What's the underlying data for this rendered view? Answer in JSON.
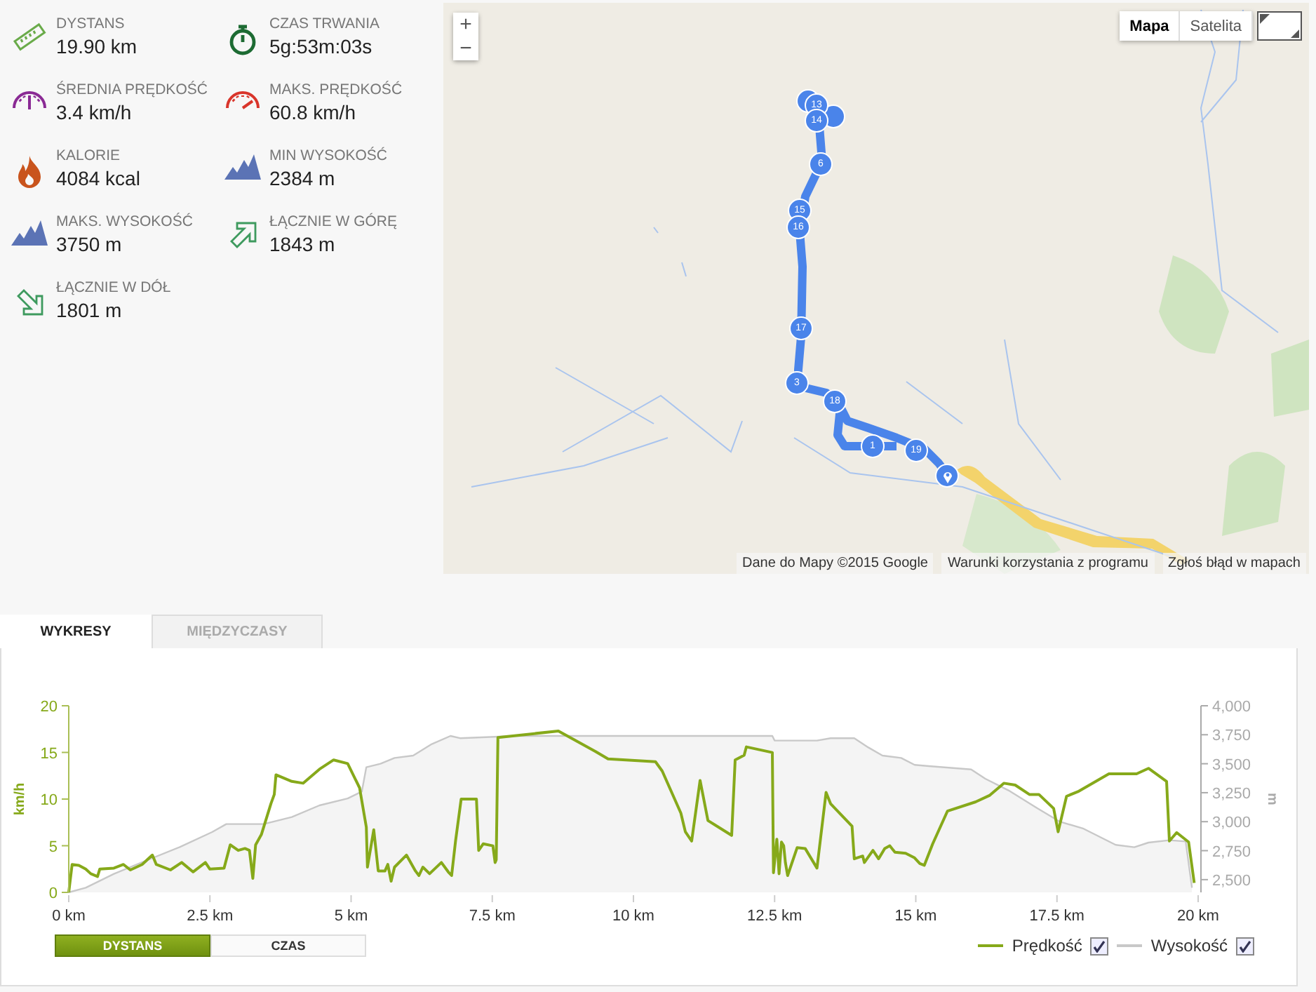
{
  "stats": [
    {
      "kind": "distance",
      "label": "DYSTANS",
      "value": "19.90 km"
    },
    {
      "kind": "duration",
      "label": "CZAS TRWANIA",
      "value": "5g:53m:03s"
    },
    {
      "kind": "avg_speed",
      "label": "ŚREDNIA PRĘDKOŚĆ",
      "value": "3.4 km/h"
    },
    {
      "kind": "max_speed",
      "label": "MAKS. PRĘDKOŚĆ",
      "value": "60.8 km/h"
    },
    {
      "kind": "calories",
      "label": "KALORIE",
      "value": "4084 kcal"
    },
    {
      "kind": "min_elevation",
      "label": "MIN WYSOKOŚĆ",
      "value": "2384 m"
    },
    {
      "kind": "max_elevation",
      "label": "MAKS. WYSOKOŚĆ",
      "value": "3750 m"
    },
    {
      "kind": "ascent",
      "label": "ŁĄCZNIE W GÓRĘ",
      "value": "1843 m"
    },
    {
      "kind": "descent",
      "label": "ŁĄCZNIE W DÓŁ",
      "value": "1801 m"
    }
  ],
  "map": {
    "zoom_in": "+",
    "zoom_out": "−",
    "map_types": [
      {
        "label": "Mapa",
        "selected": true
      },
      {
        "label": "Satelita",
        "selected": false
      }
    ],
    "markers": [
      {
        "kind": "blank"
      },
      {
        "kind": "blank"
      },
      {
        "kind": "number",
        "label": "13"
      },
      {
        "kind": "number",
        "label": "14"
      },
      {
        "kind": "number",
        "label": "6"
      },
      {
        "kind": "number",
        "label": "15"
      },
      {
        "kind": "number",
        "label": "16"
      },
      {
        "kind": "number",
        "label": "17"
      },
      {
        "kind": "number",
        "label": "3"
      },
      {
        "kind": "number",
        "label": "18"
      },
      {
        "kind": "number",
        "label": "1"
      },
      {
        "kind": "number",
        "label": "19"
      },
      {
        "kind": "pin"
      }
    ],
    "attribution": [
      "Dane do Mapy ©2015 Google",
      "Warunki korzystania z programu",
      "Zgłoś błąd w mapach"
    ]
  },
  "tabs": [
    {
      "label": "WYKRESY",
      "selected": true
    },
    {
      "label": "MIĘDZYCZASY",
      "selected": false
    }
  ],
  "chart": {
    "elevation_chart": {
      "chart_data": {
        "type": "area",
        "ylabel": "m",
        "xlim": [
          0,
          20
        ],
        "ylim": [
          2390,
          4000
        ],
        "yticks": [
          {
            "value": 2500,
            "label": "2,500"
          },
          {
            "value": 2750,
            "label": "2,750"
          },
          {
            "value": 3000,
            "label": "3,000"
          },
          {
            "value": 3250,
            "label": "3,250"
          },
          {
            "value": 3500,
            "label": "3,500"
          },
          {
            "value": 3750,
            "label": "3,750"
          },
          {
            "value": 4000,
            "label": "4,000"
          }
        ],
        "series": [
          {
            "color": "#c8c8c8",
            "x": [
              0,
              0.3,
              0.8,
              1.3,
              1.96,
              2.54,
              2.79,
              3.45,
              3.95,
              4.44,
              4.94,
              5.19,
              5.27,
              5.52,
              5.77,
              6.1,
              6.43,
              6.76,
              6.93,
              7.92,
              10.51,
              12.46,
              12.5,
              13.25,
              13.49,
              13.91,
              14.16,
              14.41,
              14.74,
              14.98,
              15.23,
              15.98,
              16.23,
              16.64,
              17.14,
              17.55,
              17.97,
              18.54,
              18.87,
              19.12,
              19.49,
              19.78,
              19.89
            ],
            "values": [
              2390,
              2430,
              2550,
              2650,
              2780,
              2910,
              2980,
              2980,
              3040,
              3140,
              3200,
              3260,
              3470,
              3500,
              3550,
              3570,
              3670,
              3740,
              3720,
              3740,
              3740,
              3740,
              3700,
              3700,
              3720,
              3720,
              3640,
              3570,
              3550,
              3490,
              3480,
              3450,
              3370,
              3270,
              3120,
              3000,
              2940,
              2800,
              2780,
              2820,
              2840,
              2830,
              2430
            ]
          }
        ]
      }
    },
    "speed_chart": {
      "chart_data": {
        "type": "line",
        "ylabel": "km/h",
        "xlim": [
          0,
          20
        ],
        "ylim": [
          0,
          20
        ],
        "xticks": [
          {
            "value": 0,
            "label": "0 km"
          },
          {
            "value": 2.5,
            "label": "2.5 km"
          },
          {
            "value": 5,
            "label": "5 km"
          },
          {
            "value": 7.5,
            "label": "7.5 km"
          },
          {
            "value": 10,
            "label": "10 km"
          },
          {
            "value": 12.5,
            "label": "12.5 km"
          },
          {
            "value": 15,
            "label": "15 km"
          },
          {
            "value": 17.5,
            "label": "17.5 km"
          },
          {
            "value": 20,
            "label": "20 km"
          }
        ],
        "yticks": [
          0,
          5,
          10,
          15,
          20
        ],
        "series": [
          {
            "color": "#86a91a",
            "x": [
              0,
              0.06,
              0.18,
              0.3,
              0.39,
              0.51,
              0.55,
              0.8,
              0.97,
              1.09,
              1.3,
              1.48,
              1.55,
              1.8,
              2.0,
              2.2,
              2.42,
              2.5,
              2.75,
              2.86,
              3.0,
              3.12,
              3.2,
              3.26,
              3.31,
              3.41,
              3.58,
              3.64,
              3.67,
              3.95,
              4.15,
              4.44,
              4.69,
              4.94,
              5.15,
              5.27,
              5.29,
              5.4,
              5.48,
              5.6,
              5.65,
              5.71,
              5.77,
              5.98,
              6.14,
              6.2,
              6.27,
              6.39,
              6.6,
              6.72,
              6.78,
              6.85,
              6.95,
              7.22,
              7.26,
              7.34,
              7.51,
              7.55,
              7.57,
              7.6,
              8.67,
              9.33,
              9.55,
              10.39,
              10.51,
              10.84,
              10.92,
              11.03,
              11.18,
              11.32,
              11.74,
              11.8,
              11.96,
              12.0,
              12.46,
              12.48,
              12.54,
              12.58,
              12.62,
              12.66,
              12.69,
              12.73,
              12.9,
              13.04,
              13.25,
              13.41,
              13.49,
              13.87,
              13.91,
              14.06,
              14.09,
              14.24,
              14.34,
              14.45,
              14.54,
              14.63,
              14.82,
              14.98,
              15.07,
              15.15,
              15.3,
              15.56,
              16.06,
              16.31,
              16.56,
              16.76,
              17.01,
              17.18,
              17.44,
              17.52,
              17.67,
              17.87,
              18.42,
              18.91,
              19.12,
              19.44,
              19.49,
              19.62,
              19.83,
              19.93
            ],
            "values": [
              0,
              3,
              2.9,
              2.5,
              2,
              1.7,
              2.5,
              2.6,
              3,
              2.4,
              3,
              4,
              3,
              2.4,
              3.2,
              2.2,
              3.2,
              2.5,
              2.6,
              5.1,
              4.5,
              4.7,
              4.5,
              1.5,
              5.1,
              6.2,
              9.5,
              10.5,
              12.6,
              11.9,
              11.7,
              13.2,
              14.2,
              13.8,
              11.2,
              7,
              2.7,
              6.7,
              2.3,
              2.3,
              3,
              1.2,
              2.7,
              4,
              2.3,
              1.8,
              2.7,
              2,
              3.2,
              2.2,
              1.8,
              5.5,
              10,
              10,
              4.5,
              5.2,
              5,
              3.2,
              3.5,
              16.6,
              17.3,
              15.1,
              14.3,
              14,
              13,
              8.5,
              6.5,
              5.5,
              12,
              7.7,
              6.1,
              14.2,
              14.7,
              15.6,
              15,
              2.1,
              5.7,
              2,
              5.4,
              5,
              3.2,
              1.8,
              4.8,
              4.7,
              2.6,
              10.7,
              9.5,
              7.1,
              3.6,
              3.9,
              3.2,
              4.5,
              3.6,
              4.7,
              5,
              4.3,
              4.2,
              3.7,
              3.1,
              2.9,
              5.2,
              8.7,
              9.7,
              10.4,
              11.7,
              11.5,
              10.5,
              10.5,
              9,
              6.5,
              10.3,
              10.8,
              12.7,
              12.7,
              13.3,
              11.9,
              5.5,
              6.4,
              5.4,
              1
            ]
          }
        ]
      }
    },
    "axis_modes": [
      {
        "label": "DYSTANS",
        "selected": true
      },
      {
        "label": "CZAS",
        "selected": false
      }
    ],
    "legend": [
      {
        "label": "Prędkość",
        "color": "#86a91a",
        "checked": true
      },
      {
        "label": "Wysokość",
        "color": "#c8c8c8",
        "checked": true
      }
    ]
  }
}
